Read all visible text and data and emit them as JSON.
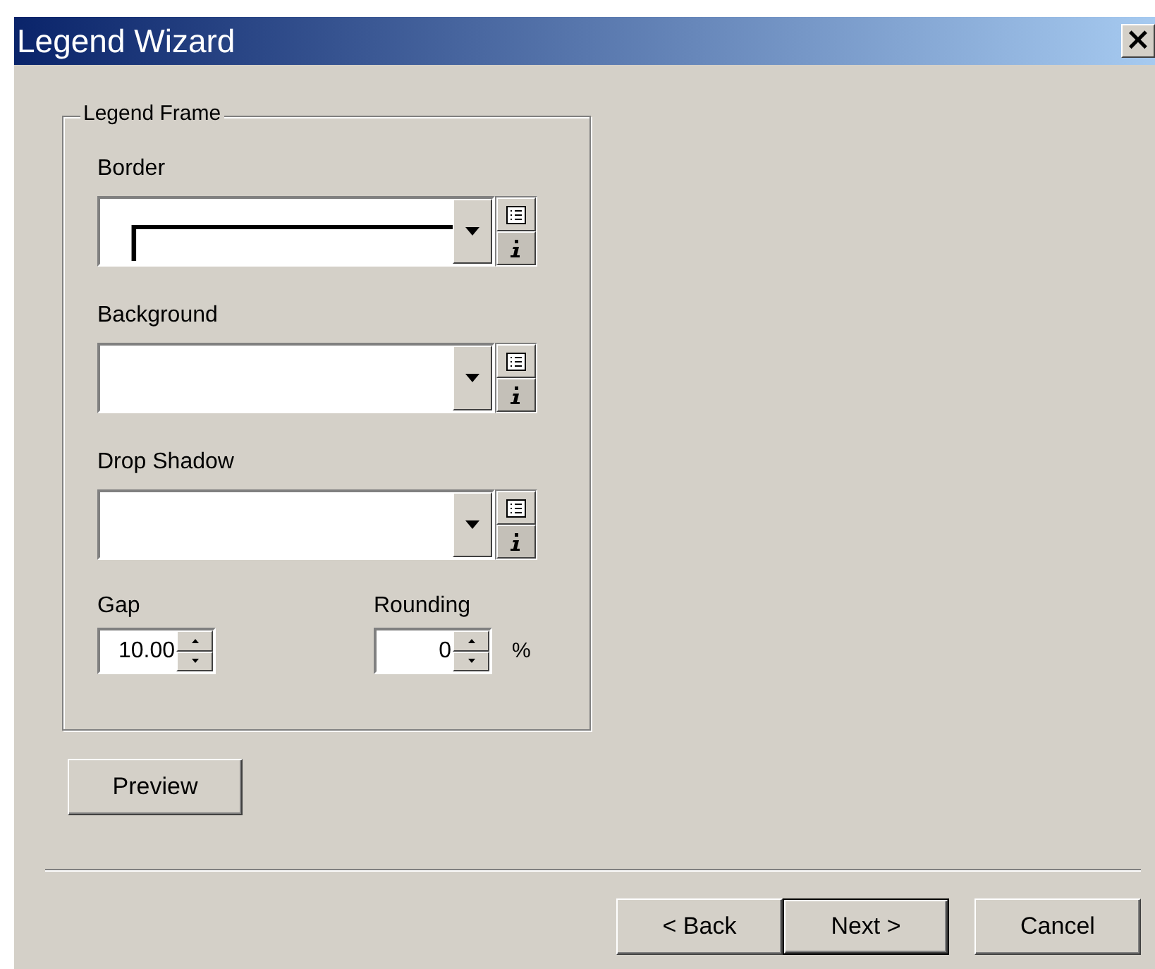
{
  "window": {
    "title": "Legend Wizard",
    "close": "×"
  },
  "group": {
    "title": "Legend Frame",
    "fields": [
      {
        "label": "Border",
        "line_preview": true
      },
      {
        "label": "Background",
        "line_preview": false
      },
      {
        "label": "Drop Shadow",
        "line_preview": false
      }
    ],
    "spinners": [
      {
        "label": "Gap",
        "value": "10.00"
      },
      {
        "label": "Rounding",
        "value": "0",
        "unit": "%"
      }
    ]
  },
  "preview_button": "Preview",
  "buttons": [
    {
      "label": "< Back",
      "default": false
    },
    {
      "label": "Next >",
      "default": true
    },
    {
      "label": "Cancel",
      "default": false
    }
  ]
}
